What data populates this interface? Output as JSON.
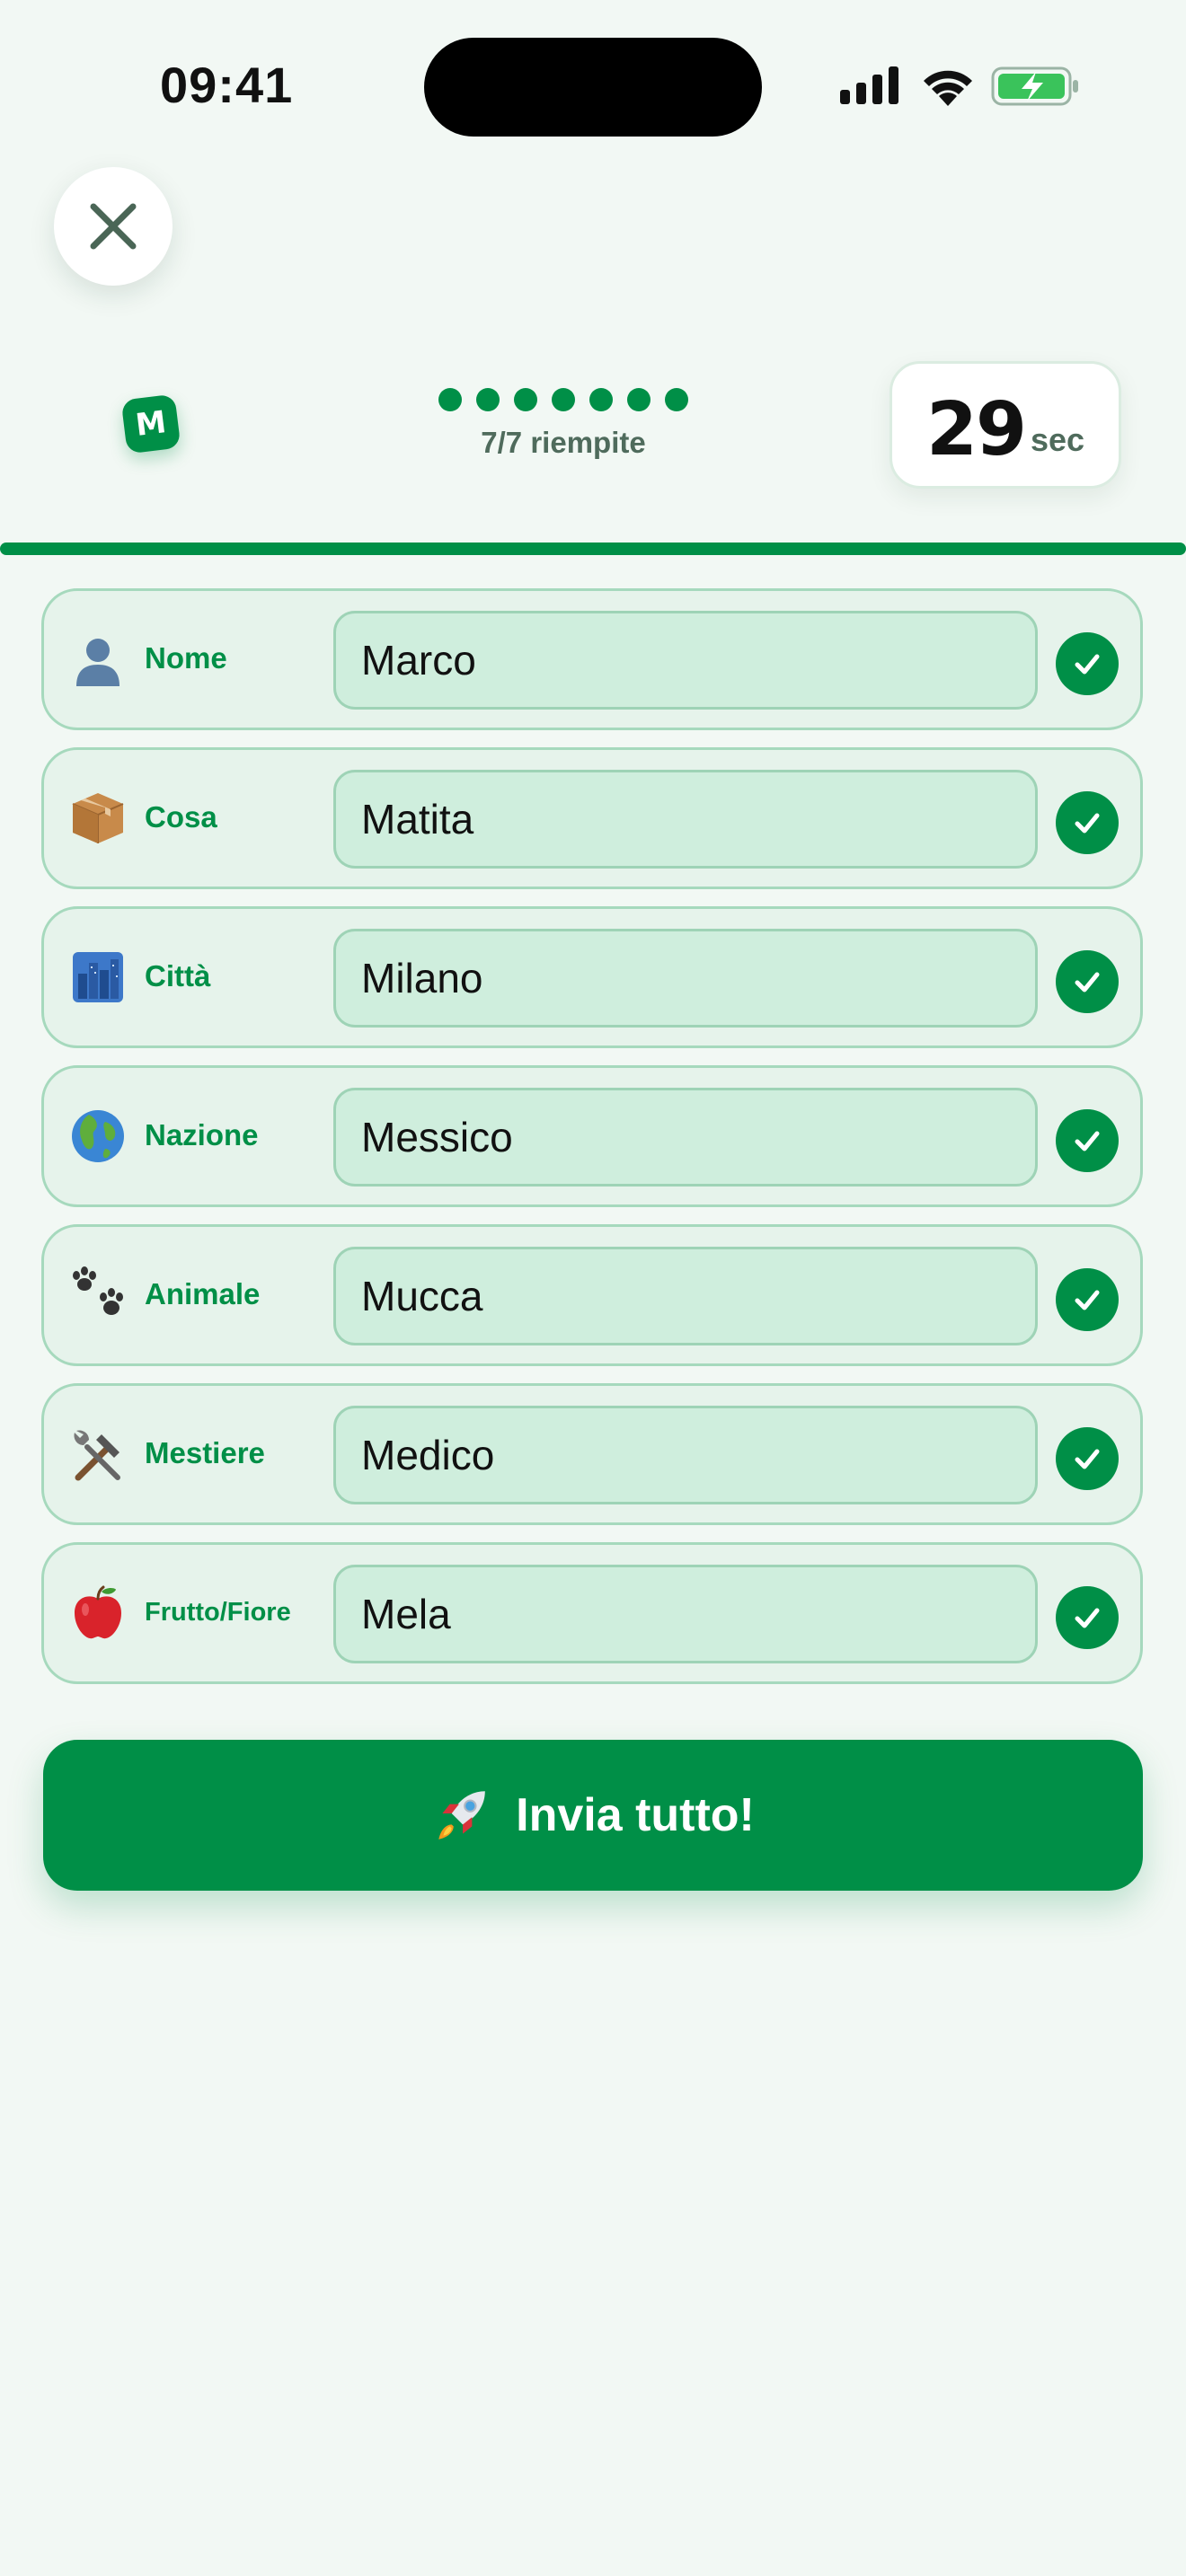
{
  "status_bar": {
    "time": "09:41"
  },
  "header": {
    "close_icon": "close-icon",
    "letter": "M",
    "progress": {
      "filled": 7,
      "total": 7,
      "text": "7/7 riempite"
    },
    "timer": {
      "value": "29",
      "unit": "sec"
    }
  },
  "fields": [
    {
      "label": "Nome",
      "icon": "person-icon",
      "value": "Marco",
      "valid": true
    },
    {
      "label": "Cosa",
      "icon": "package-icon",
      "value": "Matita",
      "valid": true
    },
    {
      "label": "Città",
      "icon": "city-icon",
      "value": "Milano",
      "valid": true
    },
    {
      "label": "Nazione",
      "icon": "globe-icon",
      "value": "Messico",
      "valid": true
    },
    {
      "label": "Animale",
      "icon": "paw-prints-icon",
      "value": "Mucca",
      "valid": true
    },
    {
      "label": "Mestiere",
      "icon": "tools-icon",
      "value": "Medico",
      "valid": true
    },
    {
      "label": "Frutto/Fiore",
      "icon": "apple-icon",
      "value": "Mela",
      "valid": true
    }
  ],
  "submit": {
    "label": "Invia tutto!",
    "icon": "rocket-icon"
  },
  "colors": {
    "accent": "#008f47",
    "background": "#f2f8f4",
    "row_bg": "#e6f3eb",
    "input_bg": "#cfeedd",
    "muted_text": "#4f6b5c"
  }
}
